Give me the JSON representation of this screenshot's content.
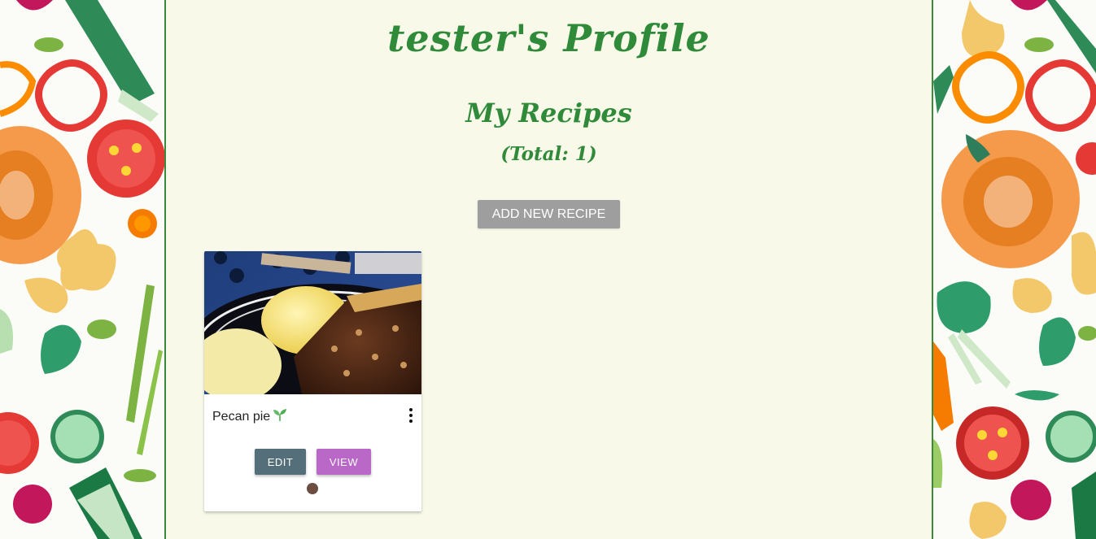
{
  "profile": {
    "title": "tester's Profile",
    "section_title": "My Recipes",
    "total_text": "(Total: 1)",
    "add_button_label": "ADD NEW RECIPE"
  },
  "recipes": [
    {
      "name": "Pecan pie",
      "badge_icon": "seedling-icon",
      "edit_label": "EDIT",
      "view_label": "VIEW"
    }
  ],
  "colors": {
    "accent_green": "#2f8a39",
    "page_background": "#f8f9e8",
    "add_button": "#9e9e9e",
    "edit_button": "#546e7a",
    "view_button": "#ba68c8",
    "dot": "#6d4c41"
  }
}
